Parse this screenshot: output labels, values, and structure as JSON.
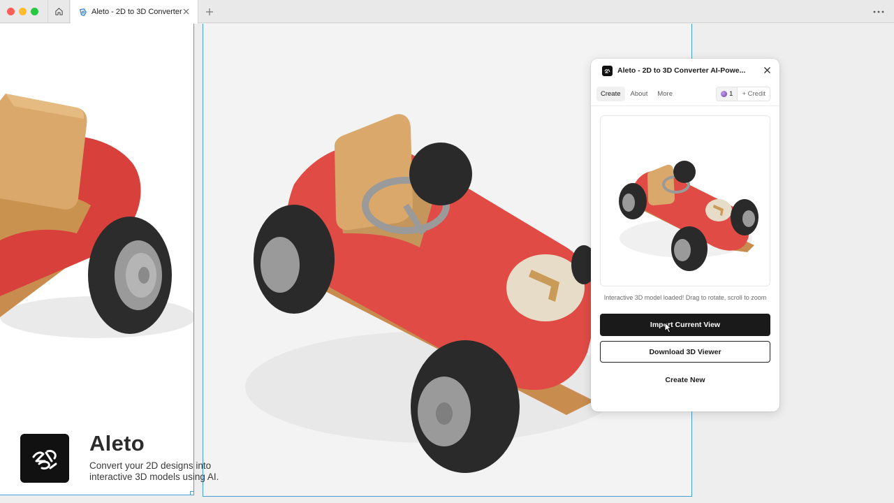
{
  "browser": {
    "tab_title": "Aleto - 2D to 3D Converter",
    "icons": {
      "home": "home-icon",
      "tab": "shield-icon",
      "close": "close-icon",
      "new_tab": "plus-icon",
      "more": "more-horizontal-icon"
    }
  },
  "brand": {
    "logo_text": "2D 3D",
    "name": "Aleto",
    "tagline": "Convert your 2D designs into interactive 3D models using AI."
  },
  "panel": {
    "title": "Aleto - 2D to 3D Converter AI-Powe...",
    "tabs": [
      {
        "label": "Create",
        "active": true
      },
      {
        "label": "About",
        "active": false
      },
      {
        "label": "More",
        "active": false
      }
    ],
    "credits": {
      "count": "1",
      "add_label": "+ Credit"
    },
    "status": "Interactive 3D model loaded! Drag to rotate, scroll to zoom",
    "primary_button": "Import Current View",
    "secondary_button": "Download 3D Viewer",
    "link_button": "Create New"
  },
  "colors": {
    "accent": "#4a9ed6",
    "car_body": "#e04b45",
    "seat": "#d9a86a",
    "tire": "#2a2a2a",
    "button_dark": "#1a1a1a"
  }
}
